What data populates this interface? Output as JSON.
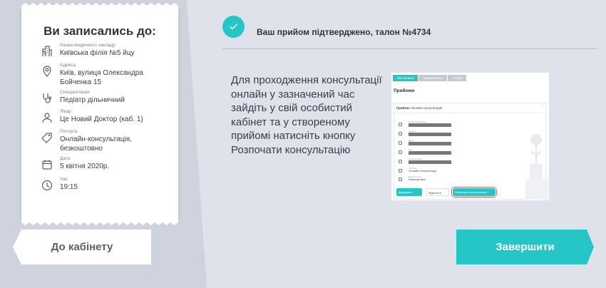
{
  "ticket": {
    "title": "Ви записались до:",
    "rows": [
      {
        "icon": "building-icon",
        "caption": "Назва медичного закладу",
        "value": "Київська філія №5 йцу"
      },
      {
        "icon": "location-pin-icon",
        "caption": "Адреса",
        "value": "Київ, вулиця Олександра Бойченка 15"
      },
      {
        "icon": "stethoscope-icon",
        "caption": "Спеціалізація",
        "value": "Педіатр дільничний"
      },
      {
        "icon": "doctor-icon",
        "caption": "Лікар",
        "value": "Це Новий Доктор (каб. 1)"
      },
      {
        "icon": "price-tag-icon",
        "caption": "Послуга",
        "value": "Онлайн-консультація, безкоштовно"
      },
      {
        "icon": "calendar-icon",
        "caption": "Дата",
        "value": "5 квітня 2020р."
      },
      {
        "icon": "clock-icon",
        "caption": "Час",
        "value": "19:15"
      }
    ]
  },
  "buttons": {
    "cabinet": "До кабінету",
    "finish": "Завершити"
  },
  "confirmation": {
    "text": "Ваш прийом підтверджено, талон №4734"
  },
  "instructions": "Для проходження консультації онлайн у зазначений час зайдіть у свій особистий кабінет та у створеному прийомі натисніть кнопку Розпочати консультацію",
  "screenshot": {
    "tabs": [
      "Мої записи",
      "Направлення",
      "Історія"
    ],
    "heading": "Прийоми",
    "card_label": "Прийом:",
    "card_value": "Онлайн консультація",
    "rows": [
      {
        "caption": "Медичний заклад",
        "kind": "bar"
      },
      {
        "caption": "Адреса",
        "kind": "bar"
      },
      {
        "caption": "Дата",
        "kind": "bar"
      },
      {
        "caption": "Час",
        "kind": "bar"
      },
      {
        "caption": "Спеціалізація",
        "kind": "bar"
      },
      {
        "caption": "Послуга",
        "kind": "text",
        "value": "Онлайн консультація"
      },
      {
        "caption": "Ціна послуги",
        "kind": "text",
        "value": "Безкоштовно"
      }
    ],
    "btn_print": "Друкувати",
    "btn_cancel": "Відмінити",
    "btn_start": "Розпочати консультацію"
  },
  "colors": {
    "accent": "#27c6c6",
    "highlight": "#e55d5d",
    "background": "#dfe2ea",
    "panel": "#cfd3dd"
  }
}
